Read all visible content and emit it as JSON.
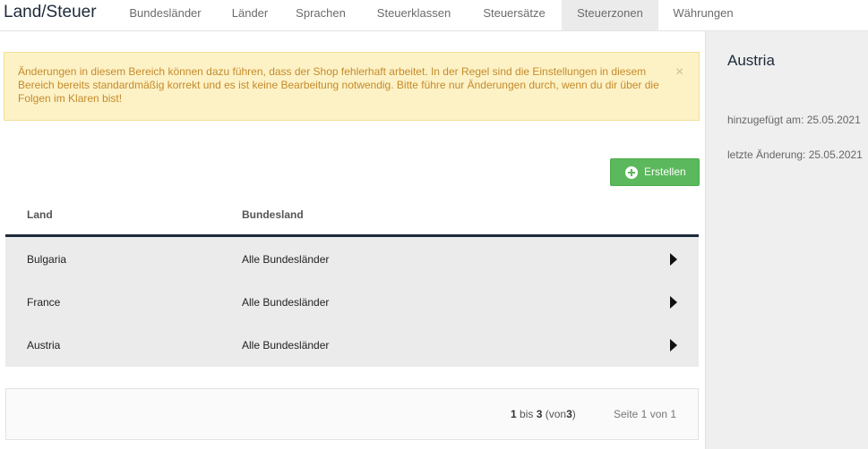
{
  "app": {
    "title": "Land/Steuer"
  },
  "nav": [
    {
      "label": "Bundesländer"
    },
    {
      "label": "Länder"
    },
    {
      "label": "Sprachen"
    },
    {
      "label": "Steuerklassen"
    },
    {
      "label": "Steuersätze"
    },
    {
      "label": "Steuerzonen",
      "active": true
    },
    {
      "label": "Währungen"
    }
  ],
  "alert": {
    "text": "Änderungen in diesem Bereich können dazu führen, dass der Shop fehlerhaft arbeitet. In der Regel sind die Einstellungen in diesem Bereich bereits standardmäßig korrekt und es ist keine Bearbeitung notwendig. Bitte führe nur Änderungen durch, wenn du dir über die Folgen im Klaren bist!",
    "close": "×"
  },
  "toolbar": {
    "create_label": "Erstellen"
  },
  "table": {
    "headers": {
      "land": "Land",
      "bundesland": "Bundesland"
    },
    "rows": [
      {
        "land": "Bulgaria",
        "bundesland": "Alle Bundesländer"
      },
      {
        "land": "France",
        "bundesland": "Alle Bundesländer"
      },
      {
        "land": "Austria",
        "bundesland": "Alle Bundesländer"
      }
    ]
  },
  "pager": {
    "from": "1",
    "bis": "bis",
    "to": "3",
    "von_open": "(von",
    "total": "3",
    "close_paren": ")",
    "page_text": "Seite 1 von 1"
  },
  "sidebar": {
    "title": "Austria",
    "added": "hinzugefügt am: 25.05.2021",
    "modified": "letzte Änderung: 25.05.2021"
  },
  "colors": {
    "accent": "#1d2a3a",
    "success": "#5cb85c",
    "warning_bg": "#fdf2c6",
    "warning_text": "#c58a2b"
  },
  "icons": {
    "create": "plus-circle-icon",
    "row_action": "caret-right-icon",
    "alert_close": "close-icon"
  }
}
